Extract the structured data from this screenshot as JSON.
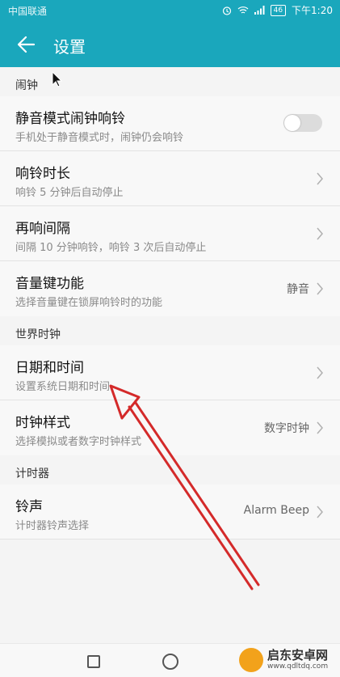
{
  "status_bar": {
    "carrier": "中国联通",
    "battery": "46",
    "time": "下午1:20"
  },
  "toolbar": {
    "title": "设置"
  },
  "sections": {
    "alarm": {
      "header": "闹钟",
      "silent_mode": {
        "title": "静音模式闹钟响铃",
        "subtitle": "手机处于静音模式时，闹钟仍会响铃",
        "enabled": false
      },
      "ring_duration": {
        "title": "响铃时长",
        "subtitle": "响铃 5 分钟后自动停止"
      },
      "snooze_interval": {
        "title": "再响间隔",
        "subtitle": "间隔 10 分钟响铃，响铃 3 次后自动停止"
      },
      "volume_key": {
        "title": "音量键功能",
        "subtitle": "选择音量键在锁屏响铃时的功能",
        "value": "静音"
      }
    },
    "world_clock": {
      "header": "世界时钟",
      "date_time": {
        "title": "日期和时间",
        "subtitle": "设置系统日期和时间"
      },
      "clock_style": {
        "title": "时钟样式",
        "subtitle": "选择模拟或者数字时钟样式",
        "value": "数字时钟"
      }
    },
    "timer": {
      "header": "计时器",
      "ringtone": {
        "title": "铃声",
        "subtitle": "计时器铃声选择",
        "value": "Alarm Beep"
      }
    }
  },
  "watermark": {
    "name": "启东安卓网",
    "url": "www.qdltdq.com"
  },
  "colors": {
    "app_bar": "#1aa7bc",
    "annotation_arrow": "#d42a2a"
  },
  "icons": [
    "back-arrow-icon",
    "chevron-right-icon",
    "alarm-clock-icon",
    "wifi-icon",
    "signal-icon",
    "battery-icon",
    "recents-icon",
    "home-icon"
  ]
}
